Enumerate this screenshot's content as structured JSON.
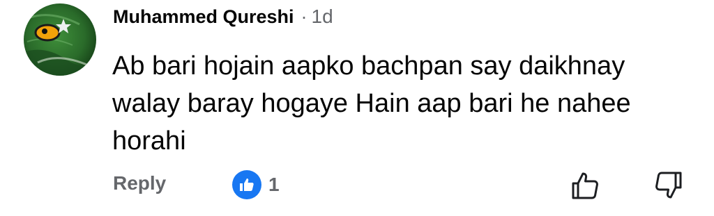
{
  "comment": {
    "author": "Muhammed Qureshi",
    "separator": "·",
    "time": "1d",
    "text": "Ab bari hojain aapko bachpan say daikhnay walay baray hogaye Hain aap bari he nahee horahi",
    "reply_label": "Reply",
    "reaction_count": "1",
    "reaction_icon": "like-icon",
    "upvote_icon": "thumbs-up-outline-icon",
    "downvote_icon": "thumbs-down-outline-icon",
    "colors": {
      "like_badge": "#1877f2",
      "secondary_text": "#65676b",
      "primary_text": "#050505"
    }
  }
}
